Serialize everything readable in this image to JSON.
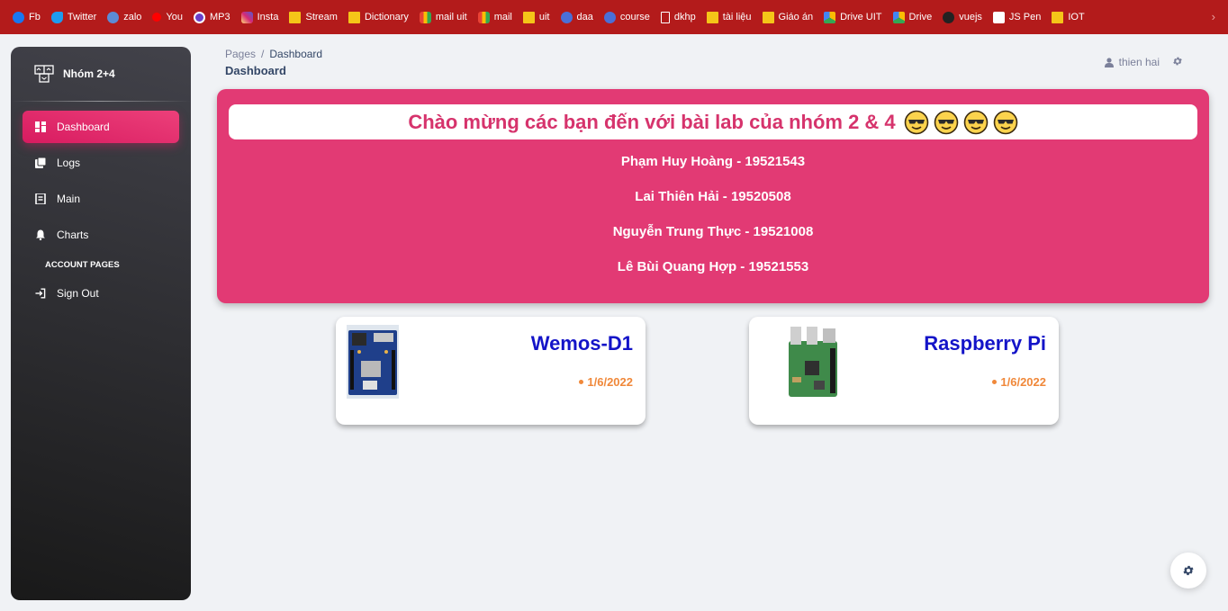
{
  "bookmarks": [
    {
      "label": "Fb",
      "icon": "facebook-icon",
      "color": "#1877f2"
    },
    {
      "label": "Twitter",
      "icon": "twitter-icon",
      "color": "#1d9bf0"
    },
    {
      "label": "zalo",
      "icon": "zalo-icon",
      "color": "#5c8bd6"
    },
    {
      "label": "You",
      "icon": "youtube-icon",
      "color": "#ff0000"
    },
    {
      "label": "MP3",
      "icon": "mp3-icon",
      "color": "#6a3fc8"
    },
    {
      "label": "Insta",
      "icon": "instagram-icon",
      "color": "#d62976"
    },
    {
      "label": "Stream",
      "icon": "folder-icon",
      "color": "#f5c518"
    },
    {
      "label": "Dictionary",
      "icon": "folder-icon",
      "color": "#f5c518"
    },
    {
      "label": "mail uit",
      "icon": "gmail-icon",
      "color": "#ea4335"
    },
    {
      "label": "mail",
      "icon": "gmail-icon",
      "color": "#ea4335"
    },
    {
      "label": "uit",
      "icon": "folder-icon",
      "color": "#f5c518"
    },
    {
      "label": "daa",
      "icon": "globe-icon",
      "color": "#4a6fd8"
    },
    {
      "label": "course",
      "icon": "globe-icon",
      "color": "#4a6fd8"
    },
    {
      "label": "dkhp",
      "icon": "page-icon",
      "color": "#ffffff"
    },
    {
      "label": "tài liệu",
      "icon": "folder-icon",
      "color": "#f5c518"
    },
    {
      "label": "Giáo án",
      "icon": "folder-icon",
      "color": "#f5c518"
    },
    {
      "label": "Drive UIT",
      "icon": "drive-icon",
      "color": "#34a853"
    },
    {
      "label": "Drive",
      "icon": "drive-icon",
      "color": "#34a853"
    },
    {
      "label": "vuejs",
      "icon": "github-icon",
      "color": "#222222"
    },
    {
      "label": "JS Pen",
      "icon": "codepen-icon",
      "color": "#ffffff"
    },
    {
      "label": "IOT",
      "icon": "folder-icon",
      "color": "#f5c518"
    }
  ],
  "sidebar": {
    "brand": "Nhóm 2+4",
    "items": [
      {
        "label": "Dashboard",
        "icon": "dashboard-icon",
        "active": true
      },
      {
        "label": "Logs",
        "icon": "logs-icon",
        "active": false
      },
      {
        "label": "Main",
        "icon": "receipt-icon",
        "active": false
      },
      {
        "label": "Charts",
        "icon": "bell-icon",
        "active": false
      }
    ],
    "section_label": "ACCOUNT PAGES",
    "sign_out": {
      "label": "Sign Out",
      "icon": "login-icon"
    }
  },
  "header": {
    "breadcrumb_root": "Pages",
    "breadcrumb_sep": "/",
    "breadcrumb_current": "Dashboard",
    "title": "Dashboard",
    "username": "thien hai"
  },
  "banner": {
    "welcome": "Chào mừng các bạn đến với bài lab của nhóm 2 & 4",
    "emoji": "smiling-face-with-sunglasses-icon",
    "members": [
      "Phạm Huy Hoàng - 19521543",
      "Lai Thiên Hải - 19520508",
      "Nguyễn Trung Thực - 19521008",
      "Lê Bùi Quang Hợp - 19521553"
    ]
  },
  "devices": [
    {
      "name": "Wemos-D1",
      "date": "1/6/2022",
      "image": "wemos-board-image"
    },
    {
      "name": "Raspberry Pi",
      "date": "1/6/2022",
      "image": "raspberry-pi-board-image"
    }
  ],
  "colors": {
    "accent": "#e91e63",
    "banner": "#e23a74",
    "device_name": "#1414c8",
    "date": "#f0883a",
    "bookmark_bar": "#b31b1b"
  }
}
